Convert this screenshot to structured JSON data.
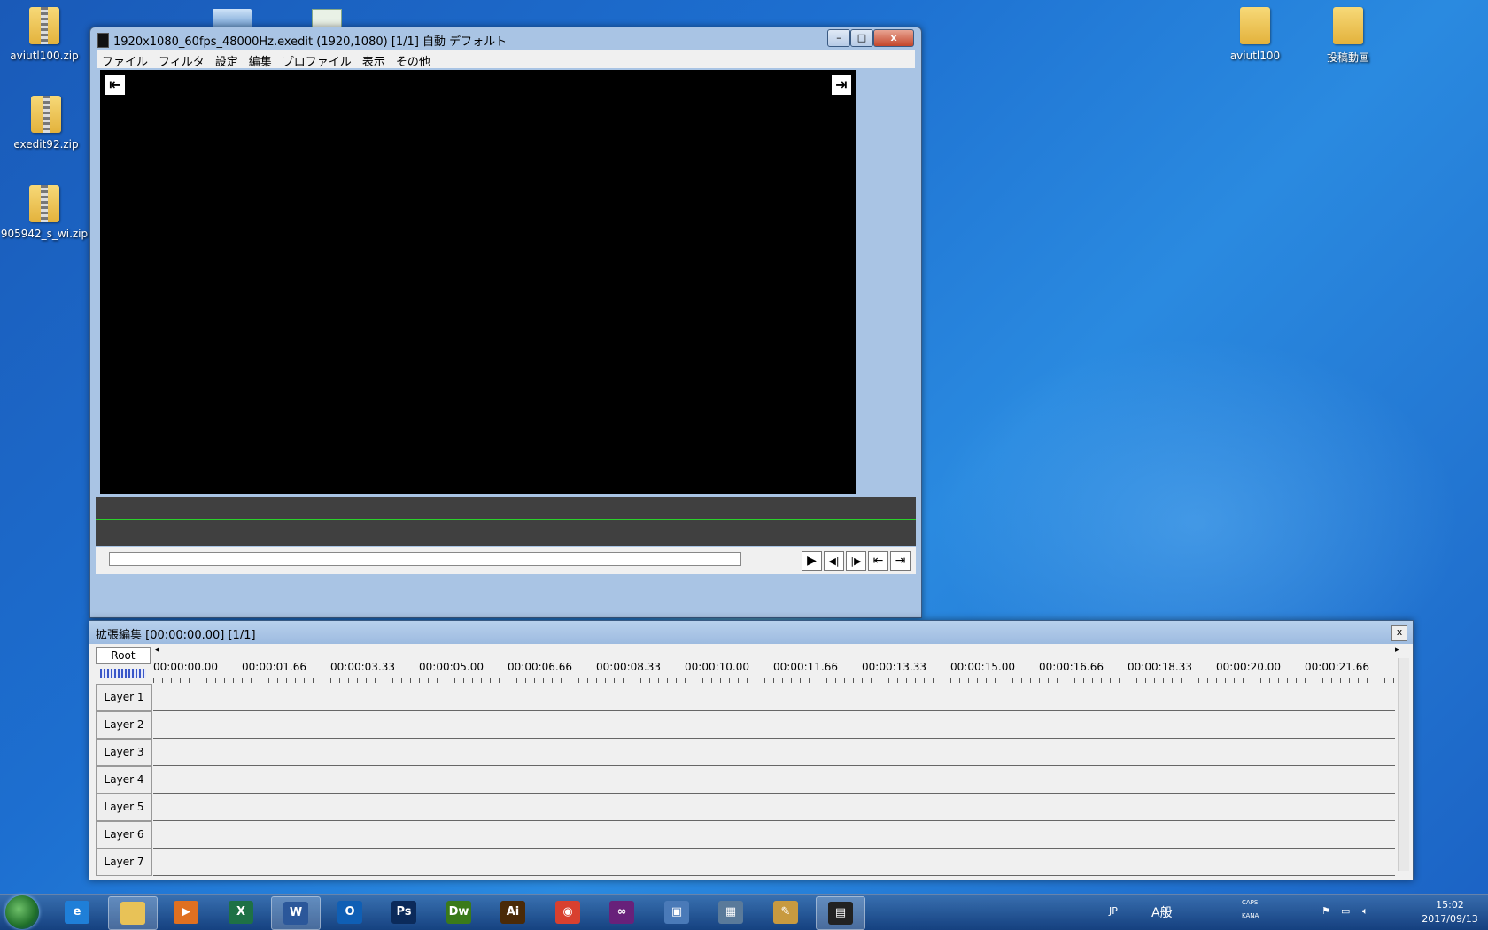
{
  "desktop": {
    "icons_left": [
      {
        "label": "aviutl100.zip",
        "type": "zip"
      },
      {
        "label": "exedit92.zip",
        "type": "zip"
      },
      {
        "label": "905942_s_wi.zip",
        "type": "zip"
      }
    ],
    "icons_right": [
      {
        "label": "aviutl100",
        "type": "folder"
      },
      {
        "label": "投稿動画",
        "type": "folder"
      }
    ]
  },
  "main_window": {
    "title": "1920x1080_60fps_48000Hz.exedit (1920,1080)  [1/1]  自動  デフォルト",
    "controls": {
      "minimize": "–",
      "maximize": "□",
      "close": "x"
    },
    "menu": [
      "ファイル",
      "フィルタ",
      "設定",
      "編集",
      "プロファイル",
      "表示",
      "その他"
    ],
    "nav_prev_icon": "⇤",
    "nav_next_icon": "⇥",
    "playback": [
      "▶",
      "◀|",
      "|▶",
      "⇤",
      "⇥"
    ]
  },
  "timeline_window": {
    "title": "拡張編集 [00:00:00.00] [1/1]",
    "close_label": "x",
    "root_label": "Root",
    "time_labels": [
      "00:00:00.00",
      "00:00:01.66",
      "00:00:03.33",
      "00:00:05.00",
      "00:00:06.66",
      "00:00:08.33",
      "00:00:10.00",
      "00:00:11.66",
      "00:00:13.33",
      "00:00:15.00",
      "00:00:16.66",
      "00:00:18.33",
      "00:00:20.00",
      "00:00:21.66"
    ],
    "layers": [
      "Layer  1",
      "Layer  2",
      "Layer  3",
      "Layer  4",
      "Layer  5",
      "Layer  6",
      "Layer  7"
    ]
  },
  "taskbar": {
    "apps": [
      {
        "name": "internet-explorer",
        "glyph": "e",
        "color": "#1f7fd8"
      },
      {
        "name": "explorer",
        "glyph": "",
        "color": "#e8c257"
      },
      {
        "name": "media-player",
        "glyph": "▶",
        "color": "#e07020"
      },
      {
        "name": "excel",
        "glyph": "X",
        "color": "#1e7145"
      },
      {
        "name": "word",
        "glyph": "W",
        "color": "#2b579a"
      },
      {
        "name": "outlook",
        "glyph": "O",
        "color": "#0f5fb5"
      },
      {
        "name": "photoshop",
        "glyph": "Ps",
        "color": "#0b2a5a"
      },
      {
        "name": "dreamweaver",
        "glyph": "Dw",
        "color": "#3a7a1a"
      },
      {
        "name": "illustrator",
        "glyph": "Ai",
        "color": "#4a2a08"
      },
      {
        "name": "chrome",
        "glyph": "◉",
        "color": "#d8402f"
      },
      {
        "name": "visual-studio",
        "glyph": "∞",
        "color": "#68217a"
      },
      {
        "name": "remote-desktop",
        "glyph": "▣",
        "color": "#4a7ab8"
      },
      {
        "name": "network",
        "glyph": "▦",
        "color": "#5a7a9a"
      },
      {
        "name": "paint",
        "glyph": "✎",
        "color": "#c89a40"
      },
      {
        "name": "aviutl",
        "glyph": "▤",
        "color": "#222222"
      }
    ],
    "tray": {
      "lang": "JP",
      "ime": "A般",
      "caps": "CAPS",
      "kana": "KANA",
      "time": "15:02",
      "date": "2017/09/13"
    }
  }
}
